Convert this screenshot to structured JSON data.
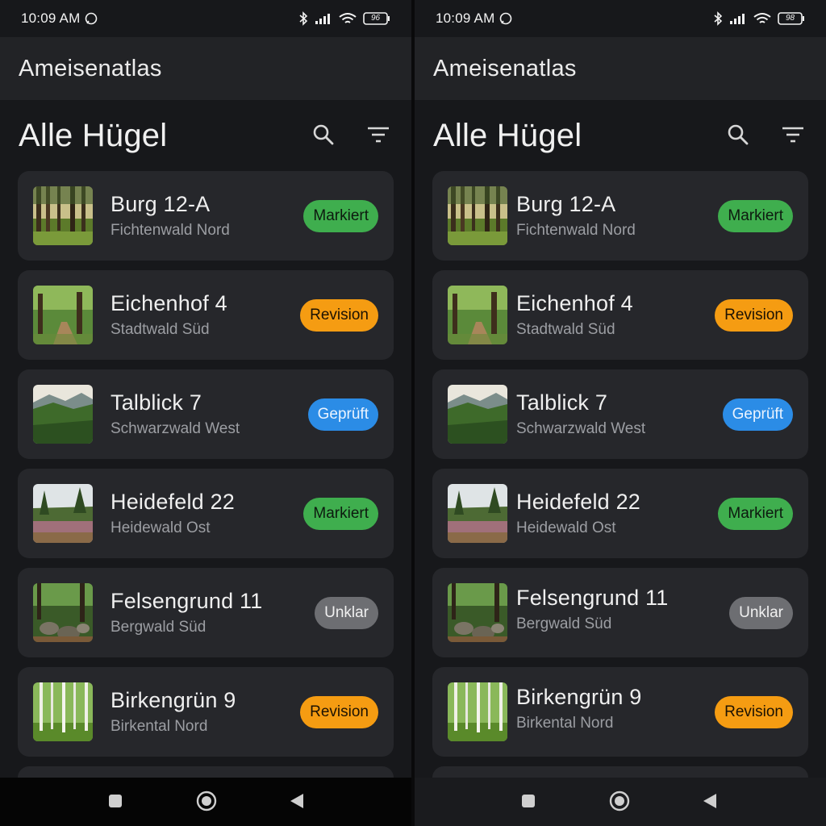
{
  "status_bar": {
    "time": "10:09 AM",
    "battery_left": "96",
    "battery_right": "98"
  },
  "app": {
    "title": "Ameisenatlas"
  },
  "page": {
    "title": "Alle Hügel"
  },
  "icons": {
    "search": "search-icon",
    "filter": "filter-icon",
    "nav_recent": "square-icon",
    "nav_home": "circle-icon",
    "nav_back": "triangle-back-icon"
  },
  "colors": {
    "markiert": "#3fae4e",
    "revision": "#f59c12",
    "geprueft": "#2b8ce6",
    "unklar": "#6d6e72"
  },
  "hills": [
    {
      "name": "Burg 12-A",
      "forest": "Fichtenwald Nord",
      "status": "Markiert",
      "status_kind": "green",
      "image": "spruce-forest"
    },
    {
      "name": "Eichenhof 4",
      "forest": "Stadtwald Süd",
      "status": "Revision",
      "status_kind": "orange",
      "image": "oak-path"
    },
    {
      "name": "Talblick 7",
      "forest": "Schwarzwald West",
      "status": "Geprüft",
      "status_kind": "blue",
      "image": "valley-view"
    },
    {
      "name": "Heidefeld 22",
      "forest": "Heidewald Ost",
      "status": "Markiert",
      "status_kind": "green",
      "image": "heath"
    },
    {
      "name": "Felsengrund 11",
      "forest": "Bergwald Süd",
      "status": "Unklar",
      "status_kind": "gray",
      "image": "rocky-forest"
    },
    {
      "name": "Birkengrün 9",
      "forest": "Birkental Nord",
      "status": "Revision",
      "status_kind": "orange",
      "image": "birch-forest"
    }
  ]
}
